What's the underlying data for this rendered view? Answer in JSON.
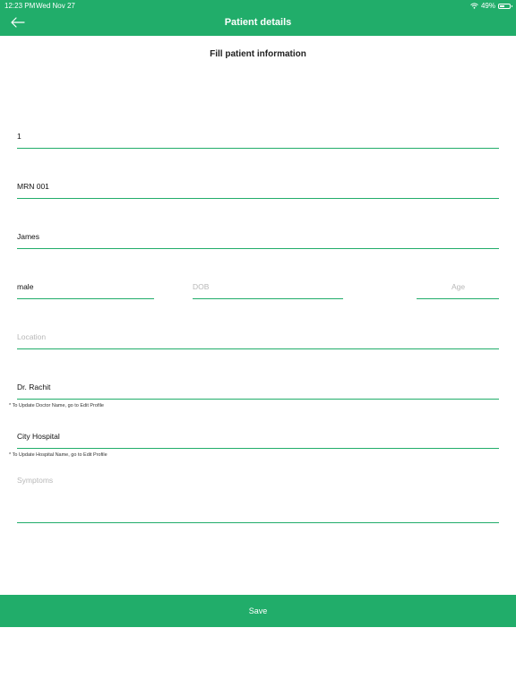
{
  "status_bar": {
    "time": "12:23 PM",
    "date": "Wed Nov 27",
    "battery": "49%",
    "battery_level": 0.49
  },
  "header": {
    "title": "Patient details",
    "back_icon": "arrow-left-icon"
  },
  "form": {
    "heading": "Fill patient information",
    "patient_id": "1",
    "mrn": "MRN 001",
    "name": "James",
    "gender": "male",
    "dob_placeholder": "DOB",
    "age_placeholder": "Age",
    "location_placeholder": "Location",
    "doctor": "Dr. Rachit",
    "doctor_note": "* To Update Doctor Name, go to Edit Profile",
    "hospital": "City Hospital",
    "hospital_note": "* To Update Hospital Name, go to Edit Profile",
    "symptoms_placeholder": "Symptoms"
  },
  "footer": {
    "save_label": "Save"
  },
  "colors": {
    "accent": "#21ad6a",
    "placeholder": "#b8b8b8"
  }
}
